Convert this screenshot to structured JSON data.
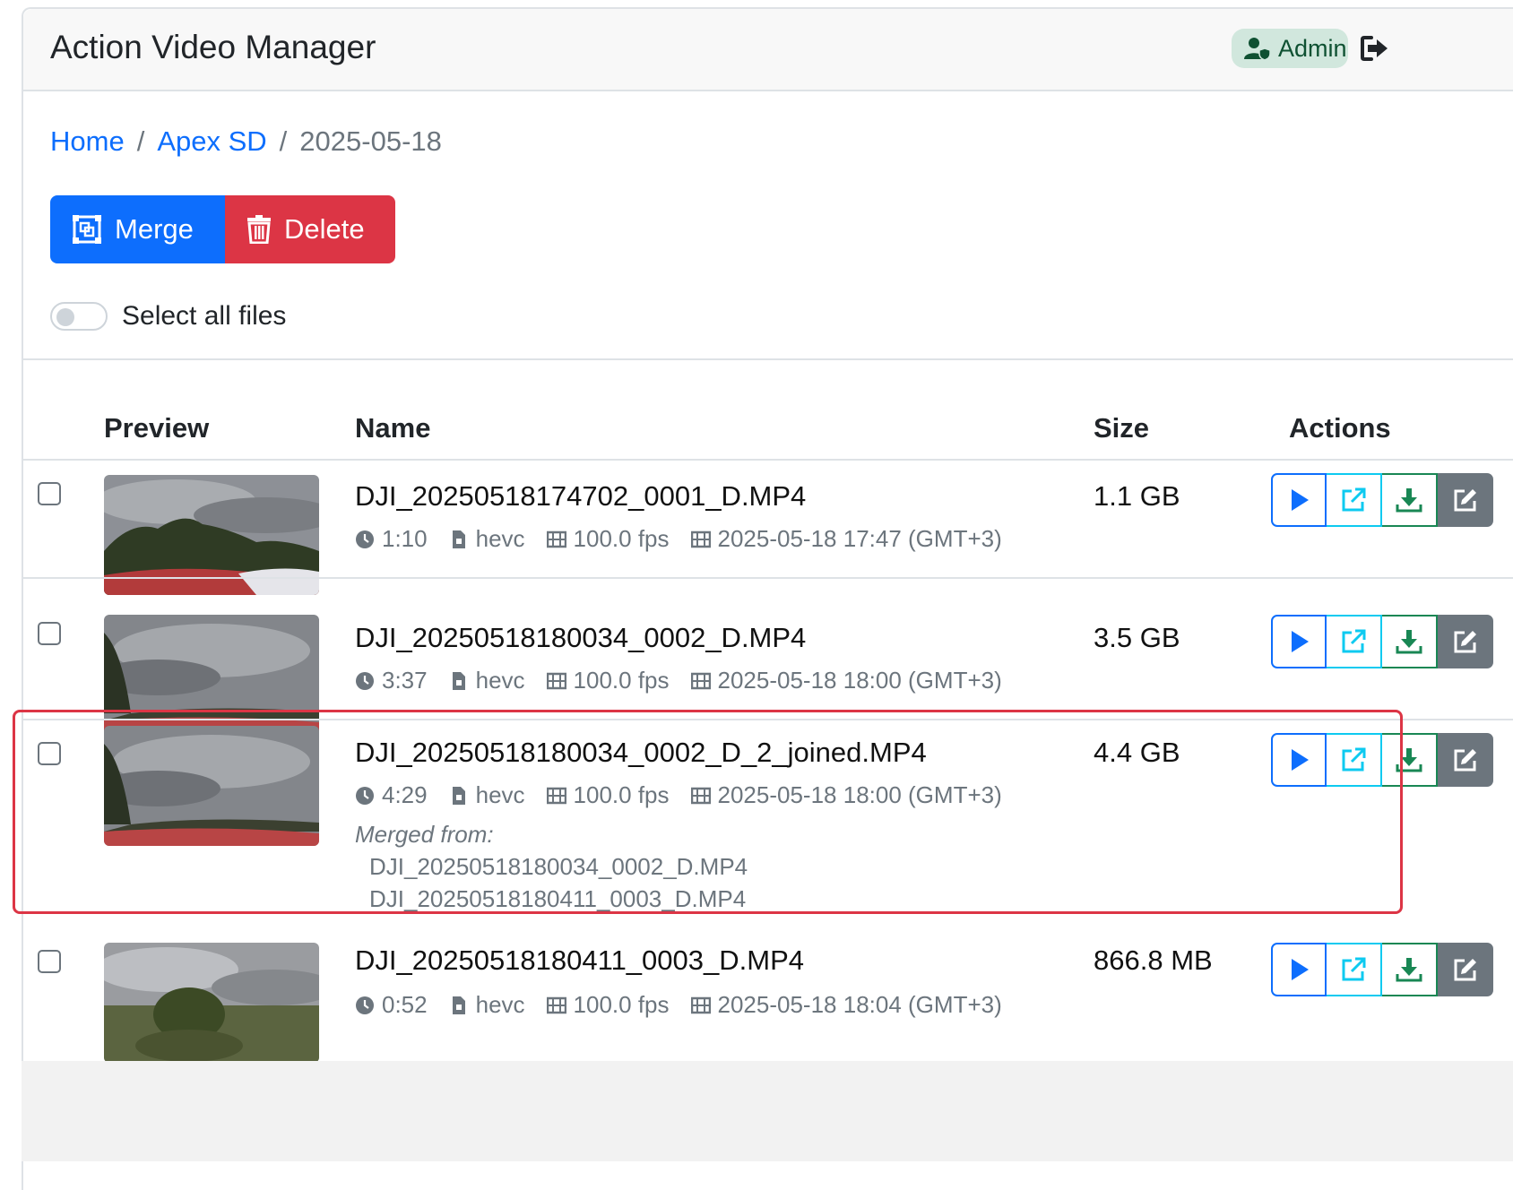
{
  "app": {
    "title": "Action Video Manager"
  },
  "user": {
    "badge": "Admin"
  },
  "breadcrumb": {
    "items": [
      "Home",
      "Apex SD"
    ],
    "current": "2025-05-18",
    "separator": "/"
  },
  "toolbar": {
    "merge_label": "Merge",
    "delete_label": "Delete",
    "select_all_label": "Select all files"
  },
  "table": {
    "headers": {
      "preview": "Preview",
      "name": "Name",
      "size": "Size",
      "actions": "Actions"
    },
    "rows": [
      {
        "name": "DJI_20250518174702_0001_D.MP4",
        "duration": "1:10",
        "codec": "hevc",
        "fps": "100.0 fps",
        "date": "2025-05-18 17:47 (GMT+3)",
        "size": "1.1 GB"
      },
      {
        "name": "DJI_20250518180034_0002_D.MP4",
        "duration": "3:37",
        "codec": "hevc",
        "fps": "100.0 fps",
        "date": "2025-05-18 18:00 (GMT+3)",
        "size": "3.5 GB"
      },
      {
        "name": "DJI_20250518180034_0002_D_2_joined.MP4",
        "duration": "4:29",
        "codec": "hevc",
        "fps": "100.0 fps",
        "date": "2025-05-18 18:00 (GMT+3)",
        "size": "4.4 GB",
        "merged_title": "Merged from:",
        "merged_from": [
          "DJI_20250518180034_0002_D.MP4",
          "DJI_20250518180411_0003_D.MP4"
        ]
      },
      {
        "name": "DJI_20250518180411_0003_D.MP4",
        "duration": "0:52",
        "codec": "hevc",
        "fps": "100.0 fps",
        "date": "2025-05-18 18:04 (GMT+3)",
        "size": "866.8 MB"
      }
    ]
  },
  "colors": {
    "primary": "#0d6efd",
    "danger": "#dc3545",
    "info": "#0dcaf0",
    "success": "#198754",
    "secondary": "#6c757d"
  }
}
